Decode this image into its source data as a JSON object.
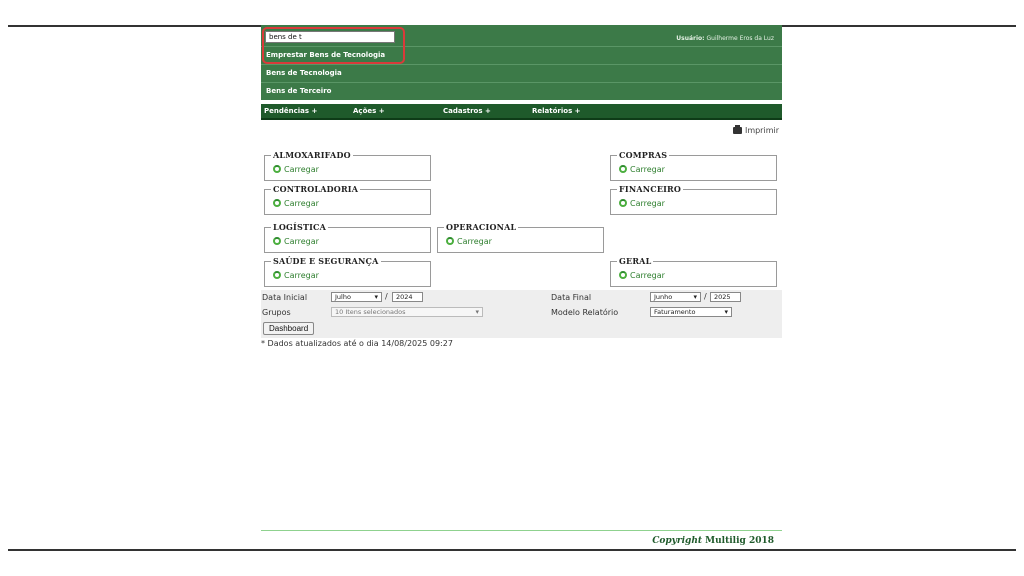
{
  "search": {
    "value": "bens de t"
  },
  "search_results": [
    "Emprestar Bens de Tecnologia",
    "Bens de Tecnologia",
    "Bens de Terceiro"
  ],
  "user": {
    "label": "Usuário:",
    "name": "Guilherme Eros da Luz"
  },
  "menu": [
    "Pendências +",
    "Ações +",
    "Cadastros +",
    "Relatórios +"
  ],
  "print_label": "Imprimir",
  "load_label": "Carregar",
  "modules": [
    "ALMOXARIFADO",
    "COMPRAS",
    "CONTROLADORIA",
    "FINANCEIRO",
    "LOGÍSTICA",
    "OPERACIONAL",
    "SAÚDE E SEGURANÇA",
    "GERAL"
  ],
  "filters": {
    "start_label": "Data Inicial",
    "start_month": "Julho",
    "start_year": "2024",
    "end_label": "Data Final",
    "end_month": "Junho",
    "end_year": "2025",
    "groups_label": "Grupos",
    "groups_value": "10 Itens selecionados",
    "model_label": "Modelo Relatório",
    "model_value": "Faturamento",
    "separator": "/"
  },
  "dashboard_button": "Dashboard",
  "update_note": "* Dados atualizados até o dia 14/08/2025 09:27",
  "copyright": {
    "italic": "Copyright",
    "rest": " Multilig 2018"
  }
}
